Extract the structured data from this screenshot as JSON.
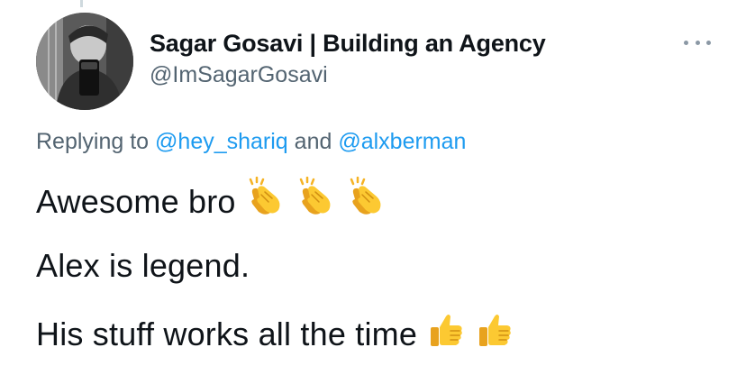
{
  "tweet": {
    "author": {
      "display_name": "Sagar Gosavi | Building an Agency",
      "handle": "@ImSagarGosavi",
      "avatar_icon": "profile-photo"
    },
    "more_icon": "more-dots-icon",
    "reply": {
      "prefix": "Replying to ",
      "mention1": "@hey_shariq",
      "conjunction": " and ",
      "mention2": "@alxberman"
    },
    "lines": [
      "Awesome bro",
      "Alex is legend.",
      "His stuff works all the time"
    ],
    "emojis": {
      "line1": [
        "clapping-hands",
        "clapping-hands",
        "clapping-hands"
      ],
      "line3": [
        "thumbs-up",
        "thumbs-up"
      ]
    },
    "colors": {
      "text": "#0f1419",
      "secondary": "#536471",
      "link": "#1d9bf0",
      "emoji": "#f5b325"
    }
  }
}
